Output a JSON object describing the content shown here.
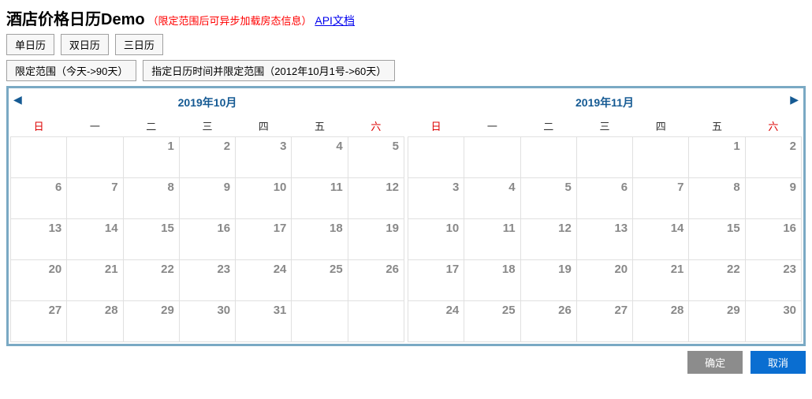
{
  "header": {
    "title": "酒店价格日历Demo",
    "subtitle": "（限定范围后可异步加载房态信息）",
    "doc_link_label": "API文档"
  },
  "toolbar_row1": {
    "single_cal": "单日历",
    "double_cal": "双日历",
    "triple_cal": "三日历"
  },
  "toolbar_row2": {
    "limit_range": "限定范围（今天->90天）",
    "set_time_range": "指定日历时间并限定范围（2012年10月1号->60天）"
  },
  "weekdays": [
    "日",
    "一",
    "二",
    "三",
    "四",
    "五",
    "六"
  ],
  "months": [
    {
      "title": "2019年10月",
      "leading_blanks": 2,
      "days": [
        1,
        2,
        3,
        4,
        5,
        6,
        7,
        8,
        9,
        10,
        11,
        12,
        13,
        14,
        15,
        16,
        17,
        18,
        19,
        20,
        21,
        22,
        23,
        24,
        25,
        26,
        27,
        28,
        29,
        30,
        31
      ]
    },
    {
      "title": "2019年11月",
      "leading_blanks": 5,
      "days": [
        1,
        2,
        3,
        4,
        5,
        6,
        7,
        8,
        9,
        10,
        11,
        12,
        13,
        14,
        15,
        16,
        17,
        18,
        19,
        20,
        21,
        22,
        23,
        24,
        25,
        26,
        27,
        28,
        29,
        30
      ]
    }
  ],
  "nav": {
    "prev": "◀",
    "next": "▶"
  },
  "footer": {
    "ok": "确定",
    "cancel": "取消"
  }
}
